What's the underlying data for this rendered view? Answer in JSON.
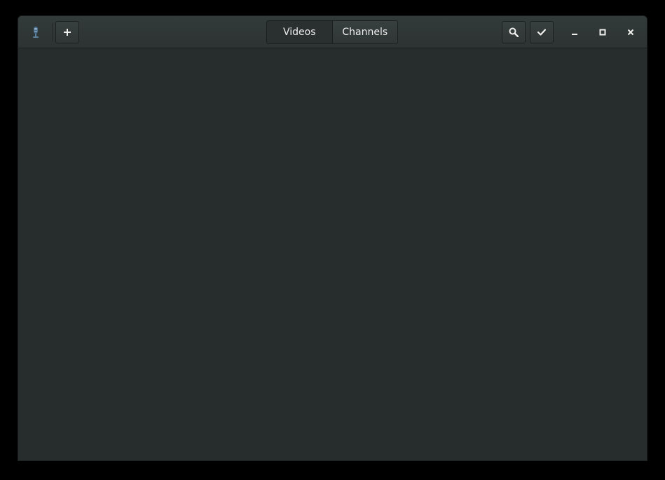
{
  "window": {
    "app_icon": "microphone-app-icon",
    "tabs": [
      {
        "label": "Videos",
        "active": true
      },
      {
        "label": "Channels",
        "active": false
      }
    ]
  },
  "toolbar": {
    "add_icon": "plus-icon",
    "search_icon": "search-icon",
    "select_icon": "checkmark-icon"
  },
  "controls": {
    "minimize_icon": "minimize-icon",
    "maximize_icon": "maximize-icon",
    "close_icon": "close-icon"
  },
  "colors": {
    "background": "#272c2c",
    "headerbar": "#2d3333",
    "text": "#eeeeec"
  }
}
